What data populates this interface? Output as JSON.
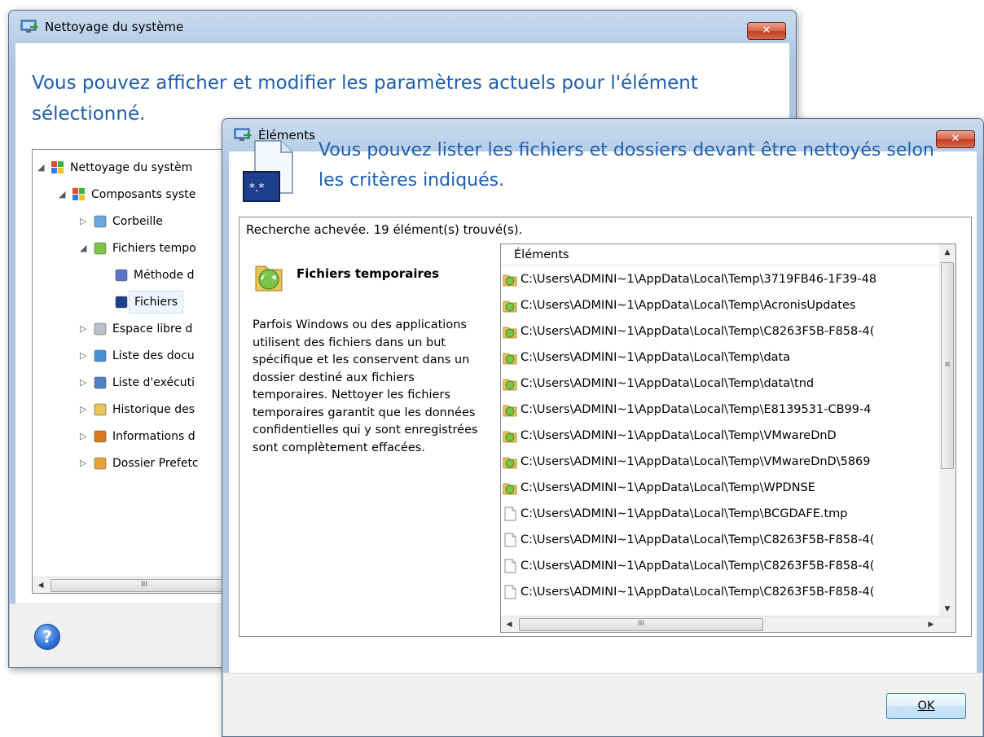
{
  "main_window": {
    "title": "Nettoyage du système",
    "close_glyph": "✕",
    "heading": "Vous pouvez afficher et modifier les paramètres actuels pour l'élément sélectionné.",
    "tree": [
      {
        "label": "Nettoyage du systèm",
        "icon": "windows-flag-icon",
        "expand": "◢",
        "level": 0
      },
      {
        "label": "Composants syste",
        "icon": "windows-flag-icon",
        "expand": "◢",
        "level": 1
      },
      {
        "label": "Corbeille",
        "icon": "recycle-bin-icon",
        "expand": "▷",
        "level": 2
      },
      {
        "label": "Fichiers tempo",
        "icon": "temp-files-icon",
        "expand": "◢",
        "level": 2
      },
      {
        "label": "Méthode d",
        "icon": "method-icon",
        "expand": "",
        "level": 3
      },
      {
        "label": "Fichiers",
        "icon": "files-icon",
        "expand": "",
        "level": 3,
        "selected": true
      },
      {
        "label": "Espace libre d",
        "icon": "disk-icon",
        "expand": "▷",
        "level": 2
      },
      {
        "label": "Liste des docu",
        "icon": "documents-icon",
        "expand": "▷",
        "level": 2
      },
      {
        "label": "Liste d'exécuti",
        "icon": "run-list-icon",
        "expand": "▷",
        "level": 2
      },
      {
        "label": "Historique des",
        "icon": "history-icon",
        "expand": "▷",
        "level": 2
      },
      {
        "label": "Informations d",
        "icon": "network-info-icon",
        "expand": "▷",
        "level": 2
      },
      {
        "label": "Dossier Prefetc",
        "icon": "prefetch-folder-icon",
        "expand": "▷",
        "level": 2
      }
    ],
    "scroll_thumb_glyph": "III",
    "help_glyph": "?"
  },
  "items_window": {
    "title": "Éléments",
    "close_glyph": "✕",
    "heading": "Vous pouvez lister les fichiers et dossiers devant être nettoyés selon les critères indiqués.",
    "status": "Recherche achevée. 19 élément(s) trouvé(s).",
    "description_title": "Fichiers temporaires",
    "description_text": "Parfois Windows ou des applications utilisent des fichiers dans un but spécifique et les conservent dans un dossier destiné aux fichiers temporaires. Nettoyer les fichiers temporaires garantit que les données confidentielles qui y sont enregistrées sont complètement effacées.",
    "column_header": "Éléments",
    "rows": [
      {
        "path": "C:\\Users\\ADMINI~1\\AppData\\Local\\Temp\\3719FB46-1F39-48",
        "icon": "temp-folder-icon"
      },
      {
        "path": "C:\\Users\\ADMINI~1\\AppData\\Local\\Temp\\AcronisUpdates",
        "icon": "temp-folder-icon"
      },
      {
        "path": "C:\\Users\\ADMINI~1\\AppData\\Local\\Temp\\C8263F5B-F858-4(",
        "icon": "temp-folder-icon"
      },
      {
        "path": "C:\\Users\\ADMINI~1\\AppData\\Local\\Temp\\data",
        "icon": "temp-folder-icon"
      },
      {
        "path": "C:\\Users\\ADMINI~1\\AppData\\Local\\Temp\\data\\tnd",
        "icon": "temp-folder-icon"
      },
      {
        "path": "C:\\Users\\ADMINI~1\\AppData\\Local\\Temp\\E8139531-CB99-4",
        "icon": "temp-folder-icon"
      },
      {
        "path": "C:\\Users\\ADMINI~1\\AppData\\Local\\Temp\\VMwareDnD",
        "icon": "temp-folder-icon"
      },
      {
        "path": "C:\\Users\\ADMINI~1\\AppData\\Local\\Temp\\VMwareDnD\\5869",
        "icon": "temp-folder-icon"
      },
      {
        "path": "C:\\Users\\ADMINI~1\\AppData\\Local\\Temp\\WPDNSE",
        "icon": "temp-folder-icon"
      },
      {
        "path": "C:\\Users\\ADMINI~1\\AppData\\Local\\Temp\\BCGDAFE.tmp",
        "icon": "file-icon"
      },
      {
        "path": "C:\\Users\\ADMINI~1\\AppData\\Local\\Temp\\C8263F5B-F858-4(",
        "icon": "file-icon"
      },
      {
        "path": "C:\\Users\\ADMINI~1\\AppData\\Local\\Temp\\C8263F5B-F858-4(",
        "icon": "file-icon"
      },
      {
        "path": "C:\\Users\\ADMINI~1\\AppData\\Local\\Temp\\C8263F5B-F858-4(",
        "icon": "file-icon"
      }
    ],
    "scroll_thumb_glyph": "III",
    "vscroll_thumb_glyph": "≡",
    "ok_label": "OK"
  },
  "colors": {
    "heading_blue": "#1e5fb0",
    "titlebar": "#bcd2ea",
    "close_red": "#c13b1e",
    "footer": "#f0f0f0"
  }
}
